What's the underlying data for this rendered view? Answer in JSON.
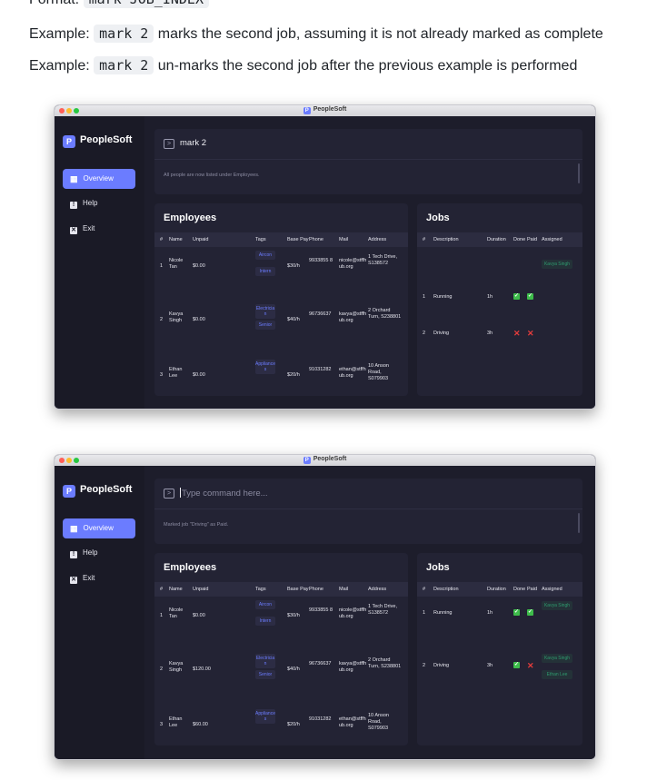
{
  "doc": {
    "format_prefix": "Format: ",
    "format_code": "mark JOB_INDEX",
    "ex1_prefix": "Example: ",
    "ex1_code": "mark 2",
    "ex1_rest": " marks the second job, assuming it is not already marked as complete",
    "ex2_prefix": "Example: ",
    "ex2_code": "mark 2",
    "ex2_rest": " un-marks the second job after the previous example is performed"
  },
  "app": {
    "window_title": "PeopleSoft",
    "logo_letter": "P",
    "logo_text": "PeopleSoft",
    "nav": [
      {
        "label": "Overview",
        "icon": "grid-icon"
      },
      {
        "label": "Help",
        "icon": "info-icon"
      },
      {
        "label": "Exit",
        "icon": "close-icon"
      }
    ],
    "employees_title": "Employees",
    "jobs_title": "Jobs",
    "emp_headers": [
      "#",
      "Name",
      "Unpaid",
      "Tags",
      "Base Pay",
      "Phone",
      "Mail",
      "Address"
    ],
    "job_headers": [
      "#",
      "Description",
      "Duration",
      "Done",
      "Paid",
      "Assigned"
    ]
  },
  "shot1": {
    "command_value": "mark 2",
    "result": "All people are now listed under Employees.",
    "employees": [
      {
        "idx": "1",
        "name": "Nicole Tan",
        "unpaid": "$0.00",
        "tags": [
          "Aircon",
          "Intern"
        ],
        "pay": "$30/h",
        "phone": "9933855 8",
        "mail": "nicole@stffh ub.org",
        "address": "1 Tech Drive, S138572"
      },
      {
        "idx": "2",
        "name": "Kavya Singh",
        "unpaid": "$0.00",
        "tags": [
          "Electricia n",
          "Senior"
        ],
        "pay": "$40/h",
        "phone": "96736637",
        "mail": "kavya@stffh ub.org",
        "address": "2 Orchard Turn, S238801"
      },
      {
        "idx": "3",
        "name": "Ethan Lee",
        "unpaid": "$0.00",
        "tags": [
          "Appliance s"
        ],
        "pay": "$20/h",
        "phone": "91031282",
        "mail": "ethan@stffh ub.org",
        "address": "10 Anson Road, S079903"
      }
    ],
    "jobs": [
      {
        "idx": "1",
        "desc": "Running",
        "duration": "1h",
        "done": true,
        "paid": true,
        "assigned": [
          "Kavya Singh"
        ]
      },
      {
        "idx": "2",
        "desc": "Driving",
        "duration": "3h",
        "done": false,
        "paid": false,
        "assigned": []
      }
    ]
  },
  "shot2": {
    "command_placeholder": "Type command here...",
    "result": "Marked job \"Driving\" as Paid.",
    "employees": [
      {
        "idx": "1",
        "name": "Nicole Tan",
        "unpaid": "$0.00",
        "tags": [
          "Aircon",
          "Intern"
        ],
        "pay": "$30/h",
        "phone": "9933855 8",
        "mail": "nicole@stffh ub.org",
        "address": "1 Tech Drive, S138572"
      },
      {
        "idx": "2",
        "name": "Kavya Singh",
        "unpaid": "$120.00",
        "tags": [
          "Electricia n",
          "Senior"
        ],
        "pay": "$40/h",
        "phone": "96736637",
        "mail": "kavya@stffh ub.org",
        "address": "2 Orchard Turn, S238801"
      },
      {
        "idx": "3",
        "name": "Ethan Lee",
        "unpaid": "$60.00",
        "tags": [
          "Appliance s"
        ],
        "pay": "$20/h",
        "phone": "91031282",
        "mail": "ethan@stffh ub.org",
        "address": "10 Anson Road, S079903"
      }
    ],
    "jobs": [
      {
        "idx": "1",
        "desc": "Running",
        "duration": "1h",
        "done": true,
        "paid": true,
        "assigned": [
          "Kavya Singh"
        ]
      },
      {
        "idx": "2",
        "desc": "Driving",
        "duration": "3h",
        "done": true,
        "paid": false,
        "assigned": [
          "Kavya Singh",
          "Ethan Lee"
        ]
      }
    ]
  },
  "colors": {
    "accent": "#6b7cff",
    "done_green": "#3ebd4b",
    "cross_red": "#e53c3c"
  }
}
